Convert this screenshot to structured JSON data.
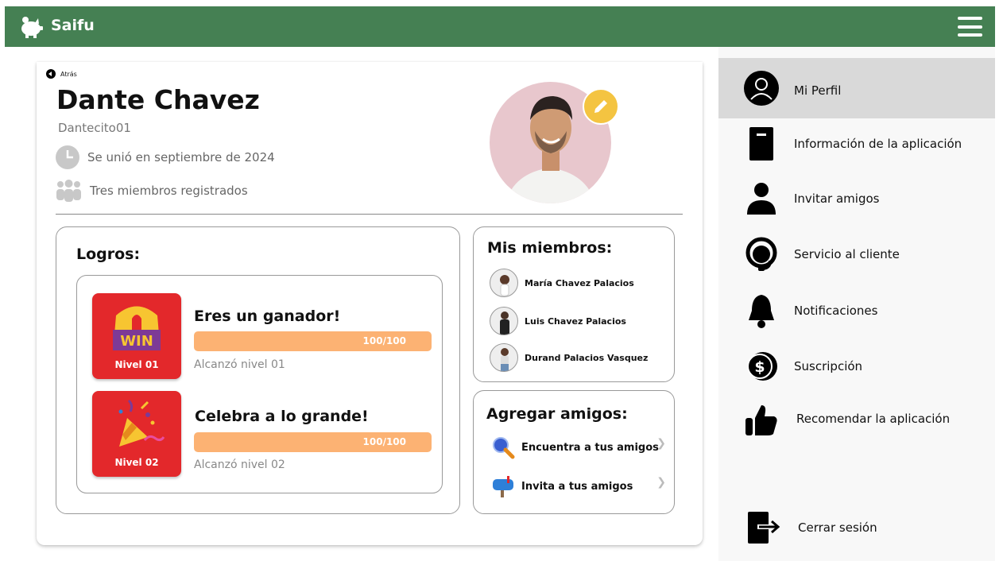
{
  "app": {
    "name": "Saifu",
    "logo_icon": "piggy-bank-icon",
    "menu_icon": "hamburger-icon"
  },
  "profile": {
    "back_label": "Atrás",
    "name": "Dante Chavez",
    "username": "Dantecito01",
    "joined": "Se unió en septiembre de 2024",
    "members_count_text": "Tres miembros registrados"
  },
  "achievements": {
    "title": "Logros:",
    "items": [
      {
        "title": "Eres un ganador!",
        "progress_text": "100/100",
        "progress": 1.0,
        "subtitle": "Alcanzó nivel 01",
        "level_label": "Nivel 01",
        "tile_text": "WIN"
      },
      {
        "title": "Celebra a lo grande!",
        "progress_text": "100/100",
        "progress": 1.0,
        "subtitle": "Alcanzó nivel 02",
        "level_label": "Nivel 02"
      }
    ]
  },
  "members": {
    "title": "Mis miembros:",
    "items": [
      {
        "name": "María Chavez Palacios"
      },
      {
        "name": "Luis Chavez Palacios"
      },
      {
        "name": "Durand Palacios Vasquez"
      }
    ]
  },
  "add_friends": {
    "title": "Agregar amigos:",
    "items": [
      {
        "label": "Encuentra a tus amigos",
        "icon": "magnifier-icon"
      },
      {
        "label": "Invita a tus amigos",
        "icon": "mailbox-icon"
      }
    ]
  },
  "sidebar": {
    "items": [
      {
        "label": "Mi Perfil",
        "icon": "profile-icon",
        "active": true
      },
      {
        "label": "Información de la aplicación",
        "icon": "book-icon"
      },
      {
        "label": "Invitar amigos",
        "icon": "person-icon"
      },
      {
        "label": "Servicio al cliente",
        "icon": "headset-icon"
      },
      {
        "label": "Notificaciones",
        "icon": "bell-icon"
      },
      {
        "label": "Suscripción",
        "icon": "coin-icon"
      },
      {
        "label": "Recomendar la aplicación",
        "icon": "thumbs-up-icon"
      }
    ],
    "logout_label": "Cerrar sesión"
  },
  "colors": {
    "header": "#458053",
    "tile": "#e3282b",
    "progress": "#fcb273",
    "edit": "#f4c441"
  }
}
